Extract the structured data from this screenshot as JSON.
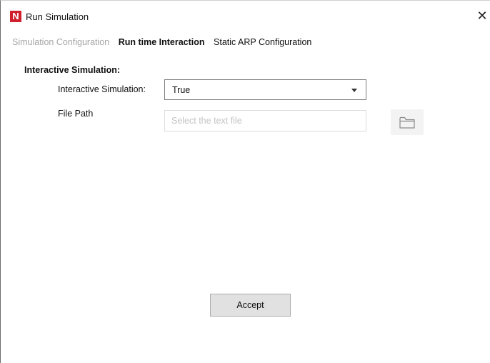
{
  "window": {
    "title": "Run Simulation",
    "logo_letter": "N",
    "close_glyph": "✕"
  },
  "tabs": [
    {
      "label": "Simulation Configuration",
      "state": "inactive"
    },
    {
      "label": "Run time Interaction",
      "state": "active"
    },
    {
      "label": "Static ARP Configuration",
      "state": "normal"
    }
  ],
  "section": {
    "heading": "Interactive Simulation:"
  },
  "form": {
    "interactive_label": "Interactive Simulation:",
    "interactive_value": "True",
    "filepath_label": "File Path",
    "filepath_value": "",
    "filepath_placeholder": "Select the text file",
    "browse_icon": "folder-icon"
  },
  "footer": {
    "accept_label": "Accept"
  },
  "colors": {
    "logo": "#d0202e",
    "inactive_tab": "#a6a6a6",
    "button_bg": "#e1e1e1"
  }
}
